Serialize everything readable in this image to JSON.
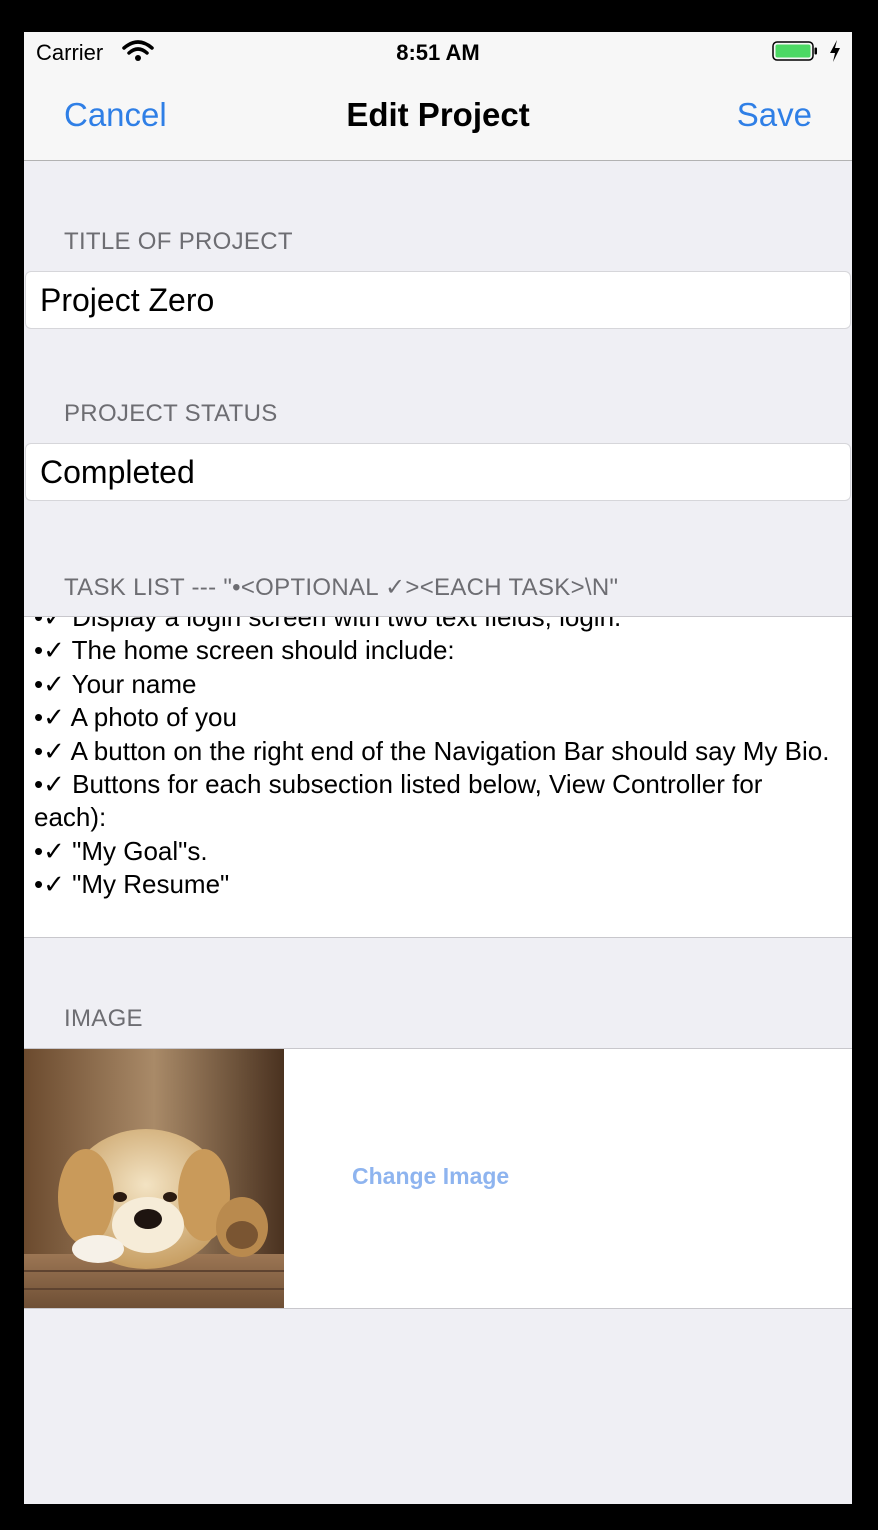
{
  "status_bar": {
    "carrier": "Carrier",
    "time": "8:51 AM",
    "battery_color": "#4cd964"
  },
  "nav_bar": {
    "cancel_label": "Cancel",
    "title": "Edit Project",
    "save_label": "Save",
    "accent_color": "#2f7fe6"
  },
  "title_section": {
    "header": "TITLE OF PROJECT",
    "value": "Project Zero"
  },
  "status_section": {
    "header": "PROJECT STATUS",
    "value": "Completed"
  },
  "task_section": {
    "header": "TASK LIST --- \"•<OPTIONAL ✓><EACH TASK>\\N\"",
    "lines": [
      "•✓ Display a login screen with two text fields, login.",
      "•✓ The home screen should include:",
      "•✓ Your name",
      "•✓ A photo of you",
      "•✓ A button on the right end of the Navigation Bar should say My Bio.",
      "•✓ Buttons for each subsection listed below, View Controller for each):",
      "•✓ \"My Goal\"s.",
      "•✓ \"My Resume\""
    ]
  },
  "image_section": {
    "header": "IMAGE",
    "change_image_label": "Change Image"
  }
}
